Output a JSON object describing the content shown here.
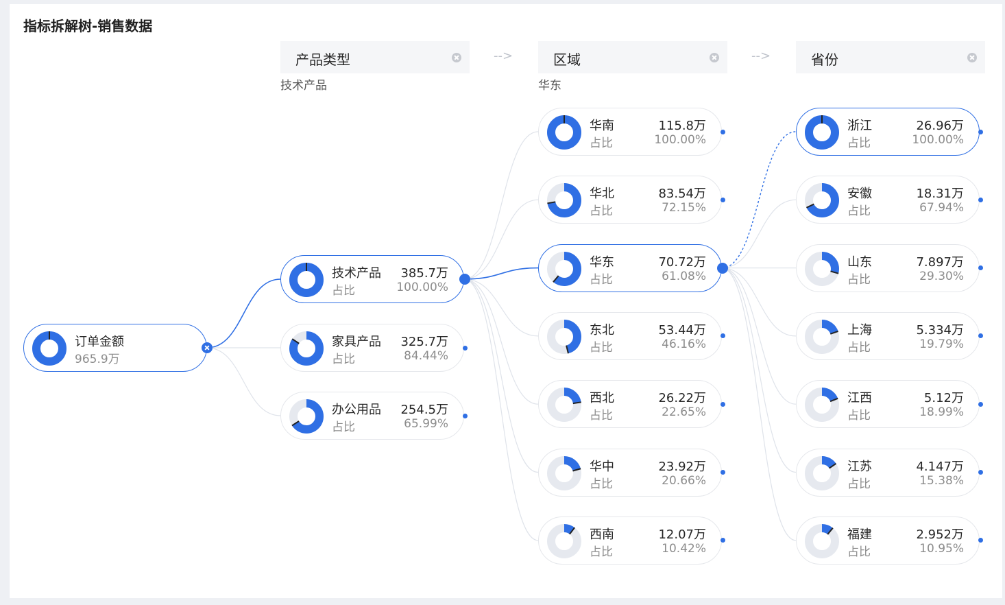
{
  "title": "指标拆解树-销售数据",
  "colors": {
    "accent": "#2f6fe4",
    "track": "#e6e9ef",
    "border": "#e5e7eb",
    "link": "#dfe3ea"
  },
  "levels": [
    {
      "header": "产品类型",
      "selected_caption": "技术产品"
    },
    {
      "header": "区域",
      "selected_caption": "华东"
    },
    {
      "header": "省份",
      "selected_caption": ""
    }
  ],
  "arrow_glyph": "-->",
  "root": {
    "name": "订单金额",
    "value": "965.9万",
    "ratio": 1.0
  },
  "product_types": [
    {
      "name": "技术产品",
      "sub": "占比",
      "value": "385.7万",
      "pct": "100.00%",
      "ratio": 1.0,
      "selected": true
    },
    {
      "name": "家具产品",
      "sub": "占比",
      "value": "325.7万",
      "pct": "84.44%",
      "ratio": 0.8444,
      "selected": false
    },
    {
      "name": "办公用品",
      "sub": "占比",
      "value": "254.5万",
      "pct": "65.99%",
      "ratio": 0.6599,
      "selected": false
    }
  ],
  "regions": [
    {
      "name": "华南",
      "sub": "占比",
      "value": "115.8万",
      "pct": "100.00%",
      "ratio": 1.0,
      "selected": false
    },
    {
      "name": "华北",
      "sub": "占比",
      "value": "83.54万",
      "pct": "72.15%",
      "ratio": 0.7215,
      "selected": false
    },
    {
      "name": "华东",
      "sub": "占比",
      "value": "70.72万",
      "pct": "61.08%",
      "ratio": 0.6108,
      "selected": true
    },
    {
      "name": "东北",
      "sub": "占比",
      "value": "53.44万",
      "pct": "46.16%",
      "ratio": 0.4616,
      "selected": false
    },
    {
      "name": "西北",
      "sub": "占比",
      "value": "26.22万",
      "pct": "22.65%",
      "ratio": 0.2265,
      "selected": false
    },
    {
      "name": "华中",
      "sub": "占比",
      "value": "23.92万",
      "pct": "20.66%",
      "ratio": 0.2066,
      "selected": false
    },
    {
      "name": "西南",
      "sub": "占比",
      "value": "12.07万",
      "pct": "10.42%",
      "ratio": 0.1042,
      "selected": false
    }
  ],
  "provinces": [
    {
      "name": "浙江",
      "sub": "占比",
      "value": "26.96万",
      "pct": "100.00%",
      "ratio": 1.0,
      "selected": true
    },
    {
      "name": "安徽",
      "sub": "占比",
      "value": "18.31万",
      "pct": "67.94%",
      "ratio": 0.6794,
      "selected": false
    },
    {
      "name": "山东",
      "sub": "占比",
      "value": "7.897万",
      "pct": "29.30%",
      "ratio": 0.293,
      "selected": false
    },
    {
      "name": "上海",
      "sub": "占比",
      "value": "5.334万",
      "pct": "19.79%",
      "ratio": 0.1979,
      "selected": false
    },
    {
      "name": "江西",
      "sub": "占比",
      "value": "5.12万",
      "pct": "18.99%",
      "ratio": 0.1899,
      "selected": false
    },
    {
      "name": "江苏",
      "sub": "占比",
      "value": "4.147万",
      "pct": "15.38%",
      "ratio": 0.1538,
      "selected": false
    },
    {
      "name": "福建",
      "sub": "占比",
      "value": "2.952万",
      "pct": "10.95%",
      "ratio": 0.1095,
      "selected": false
    }
  ]
}
